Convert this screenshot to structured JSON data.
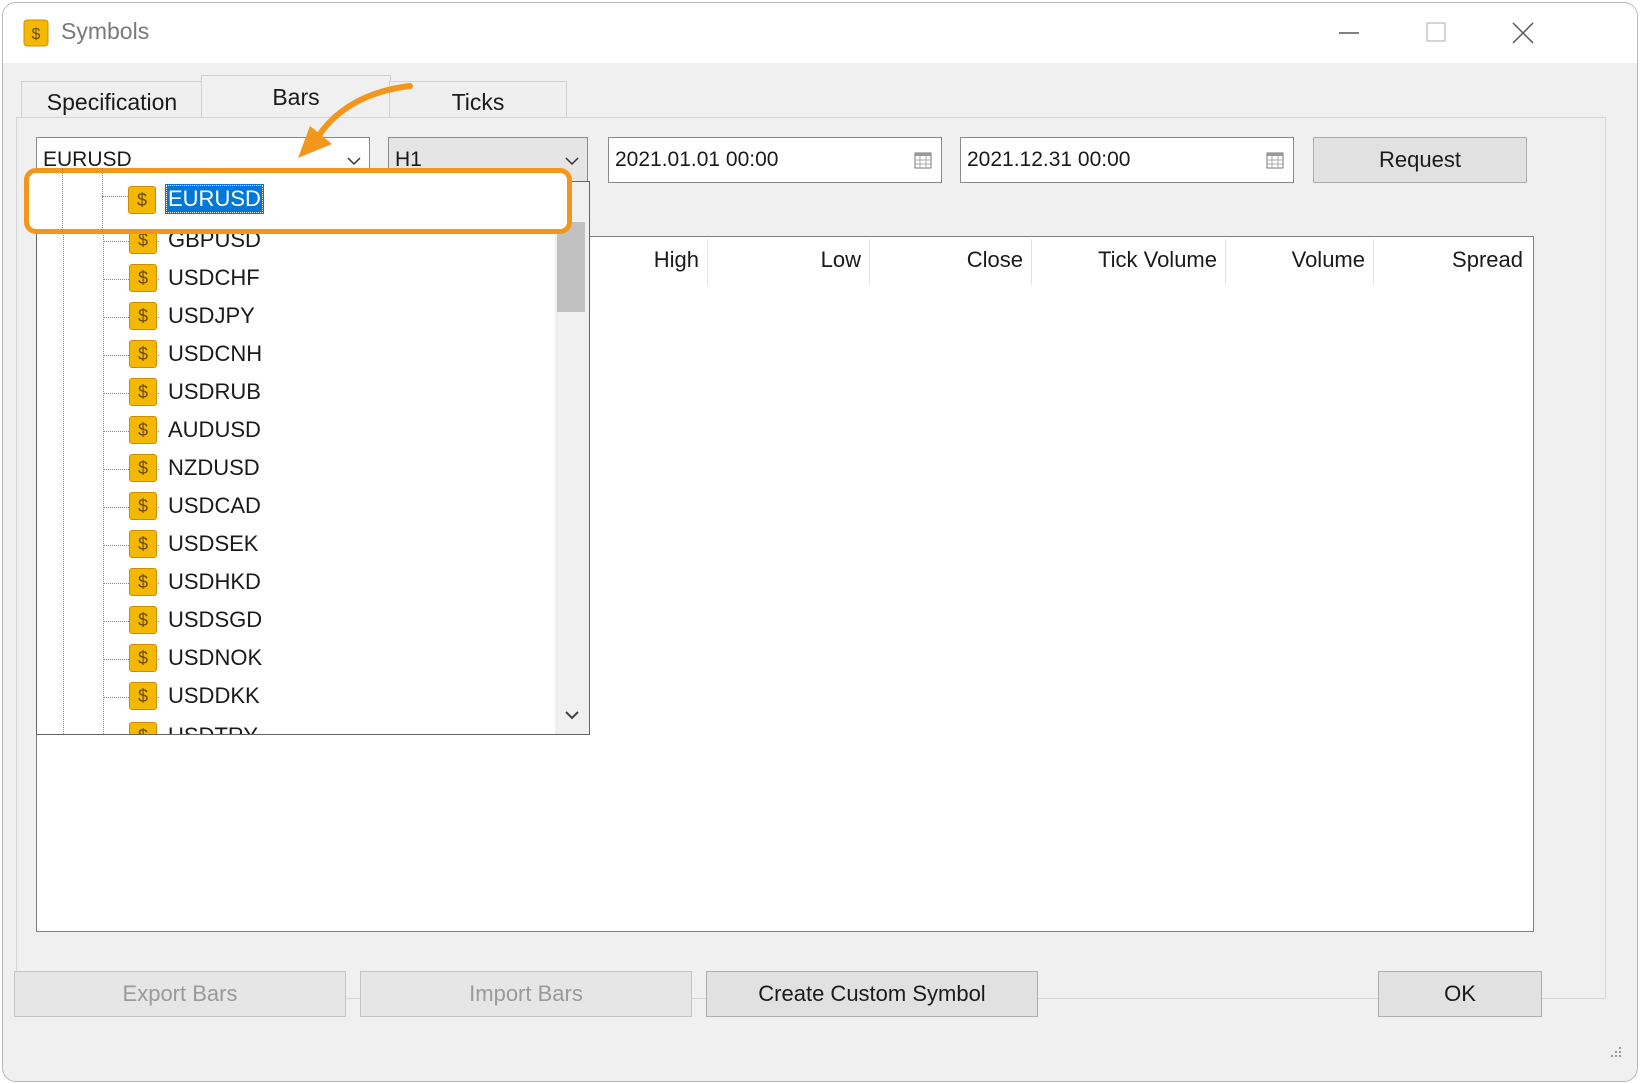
{
  "window": {
    "title": "Symbols"
  },
  "tabs": [
    {
      "label": "Specification"
    },
    {
      "label": "Bars"
    },
    {
      "label": "Ticks"
    }
  ],
  "controls": {
    "symbol_value": "EURUSD",
    "timeframe_value": "H1",
    "date_from": "2021.01.01 00:00",
    "date_to": "2021.12.31 00:00",
    "request_label": "Request"
  },
  "table": {
    "columns": [
      "High",
      "Low",
      "Close",
      "Tick Volume",
      "Volume",
      "Spread"
    ]
  },
  "dropdown": {
    "selected": "EURUSD",
    "items": [
      "GBPUSD",
      "USDCHF",
      "USDJPY",
      "USDCNH",
      "USDRUB",
      "AUDUSD",
      "NZDUSD",
      "USDCAD",
      "USDSEK",
      "USDHKD",
      "USDSGD",
      "USDNOK",
      "USDDKK",
      "USDTRY"
    ]
  },
  "footer": {
    "export_label": "Export Bars",
    "import_label": "Import Bars",
    "custom_label": "Create Custom Symbol",
    "ok_label": "OK"
  },
  "colors": {
    "accent": "#f2961c",
    "selection": "#0078d7",
    "symbol_icon": "#f5b800"
  },
  "icons": {
    "symbol": "dollar-icon",
    "calendar": "calendar-icon",
    "dropdown": "chevron-down-icon"
  }
}
